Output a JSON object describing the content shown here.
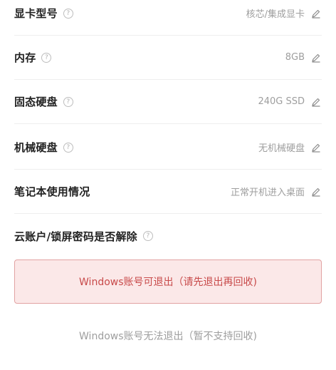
{
  "rows": [
    {
      "label": "显卡型号",
      "value": "核芯/集成显卡"
    },
    {
      "label": "内存",
      "value": "8GB"
    },
    {
      "label": "固态硬盘",
      "value": "240G SSD"
    },
    {
      "label": "机械硬盘",
      "value": "无机械硬盘"
    },
    {
      "label": "笔记本使用情况",
      "value": "正常开机进入桌面"
    }
  ],
  "question": {
    "label": "云账户/锁屏密码是否解除"
  },
  "options": [
    {
      "label": "Windows账号可退出（请先退出再回收)",
      "selected": true
    },
    {
      "label": "Windows账号无法退出（暂不支持回收)",
      "selected": false
    }
  ],
  "icons": {
    "help": "?",
    "edit": "pencil-icon"
  },
  "colors": {
    "selected_bg": "#fbe8e8",
    "selected_border": "#e2a2a2",
    "selected_text": "#c84a4a",
    "muted": "#9e9e9e"
  }
}
